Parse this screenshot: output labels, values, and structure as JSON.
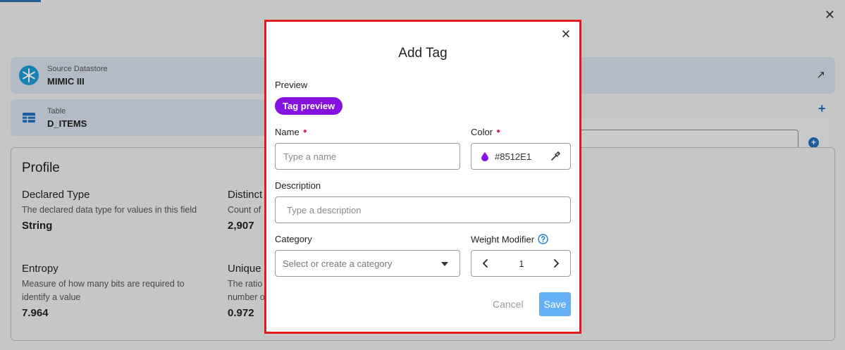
{
  "background": {
    "source_datastore": {
      "label": "Source Datastore",
      "value": "MIMIC III"
    },
    "table": {
      "label": "Table",
      "value": "D_ITEMS"
    },
    "profile": {
      "title": "Profile",
      "metrics": [
        {
          "title": "Declared Type",
          "description": "The declared data type for values in this field",
          "value": "String"
        },
        {
          "title": "Distinct",
          "description": "Count of",
          "value": "2,907"
        },
        {
          "title": "Entropy",
          "description": "Measure of how many bits are required to identify a value",
          "value": "7.964"
        },
        {
          "title": "Unique",
          "description": "The ratio number o",
          "value": "0.972"
        }
      ]
    }
  },
  "modal": {
    "title": "Add Tag",
    "close_symbol": "×",
    "preview": {
      "label": "Preview",
      "tag_text": "Tag preview",
      "tag_color": "#8512E1"
    },
    "name": {
      "label": "Name",
      "placeholder": "Type a name"
    },
    "color": {
      "label": "Color",
      "value": "#8512E1"
    },
    "description": {
      "label": "Description",
      "placeholder": "Type a description"
    },
    "category": {
      "label": "Category",
      "placeholder": "Select or create a category"
    },
    "weight_modifier": {
      "label": "Weight Modifier",
      "value": "1"
    },
    "actions": {
      "cancel": "Cancel",
      "save": "Save"
    }
  },
  "colors": {
    "accent": "#8512E1",
    "save_button": "#64b0f4",
    "required_marker": "#e0245e",
    "highlight_border": "#e3191c"
  },
  "icons": [
    "close-icon",
    "snowflake-icon",
    "table-icon",
    "external-link-icon",
    "plus-icon",
    "drop-icon",
    "eyedropper-icon",
    "caret-down-icon",
    "chevron-left-icon",
    "chevron-right-icon",
    "help-icon"
  ]
}
